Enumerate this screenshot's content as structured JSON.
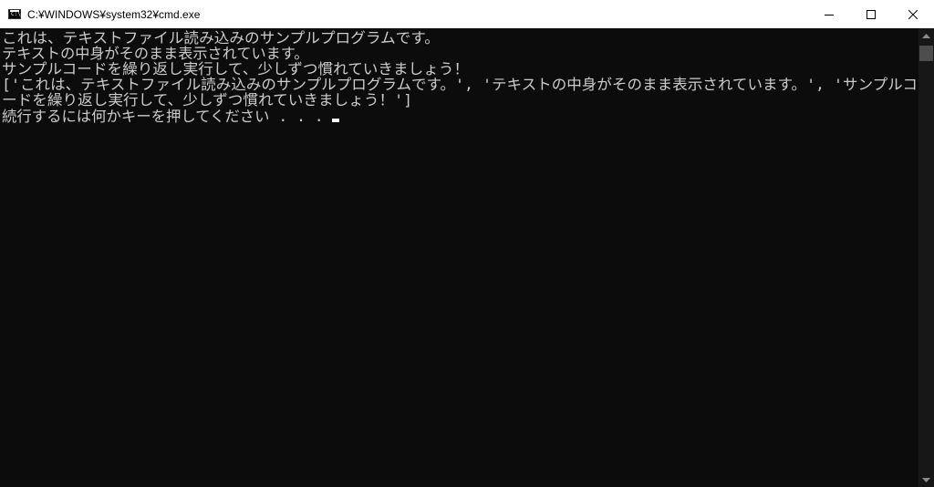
{
  "window": {
    "title": "C:¥WINDOWS¥system32¥cmd.exe",
    "icon": "cmd-prompt-icon",
    "icon_text": "C:\\."
  },
  "caption_buttons": {
    "minimize_icon": "minimize-icon",
    "maximize_icon": "maximize-icon",
    "close_icon": "close-icon"
  },
  "console": {
    "lines": [
      "これは、テキストファイル読み込みのサンプルプログラムです。",
      "テキストの中身がそのまま表示されています。",
      "サンプルコードを繰り返し実行して、少しずつ慣れていきましょう！",
      "['これは、テキストファイル読み込みのサンプルプログラムです。', 'テキストの中身がそのまま表示されています。', 'サンプルコ",
      "ードを繰り返し実行して、少しずつ慣れていきましょう！']",
      "続行するには何かキーを押してください . . . "
    ]
  },
  "colors": {
    "background": "#0c0c0c",
    "text": "#cccccc",
    "titlebar": "#ffffff",
    "scrollbar_track": "#171717",
    "scrollbar_thumb": "#4d4d4d"
  }
}
